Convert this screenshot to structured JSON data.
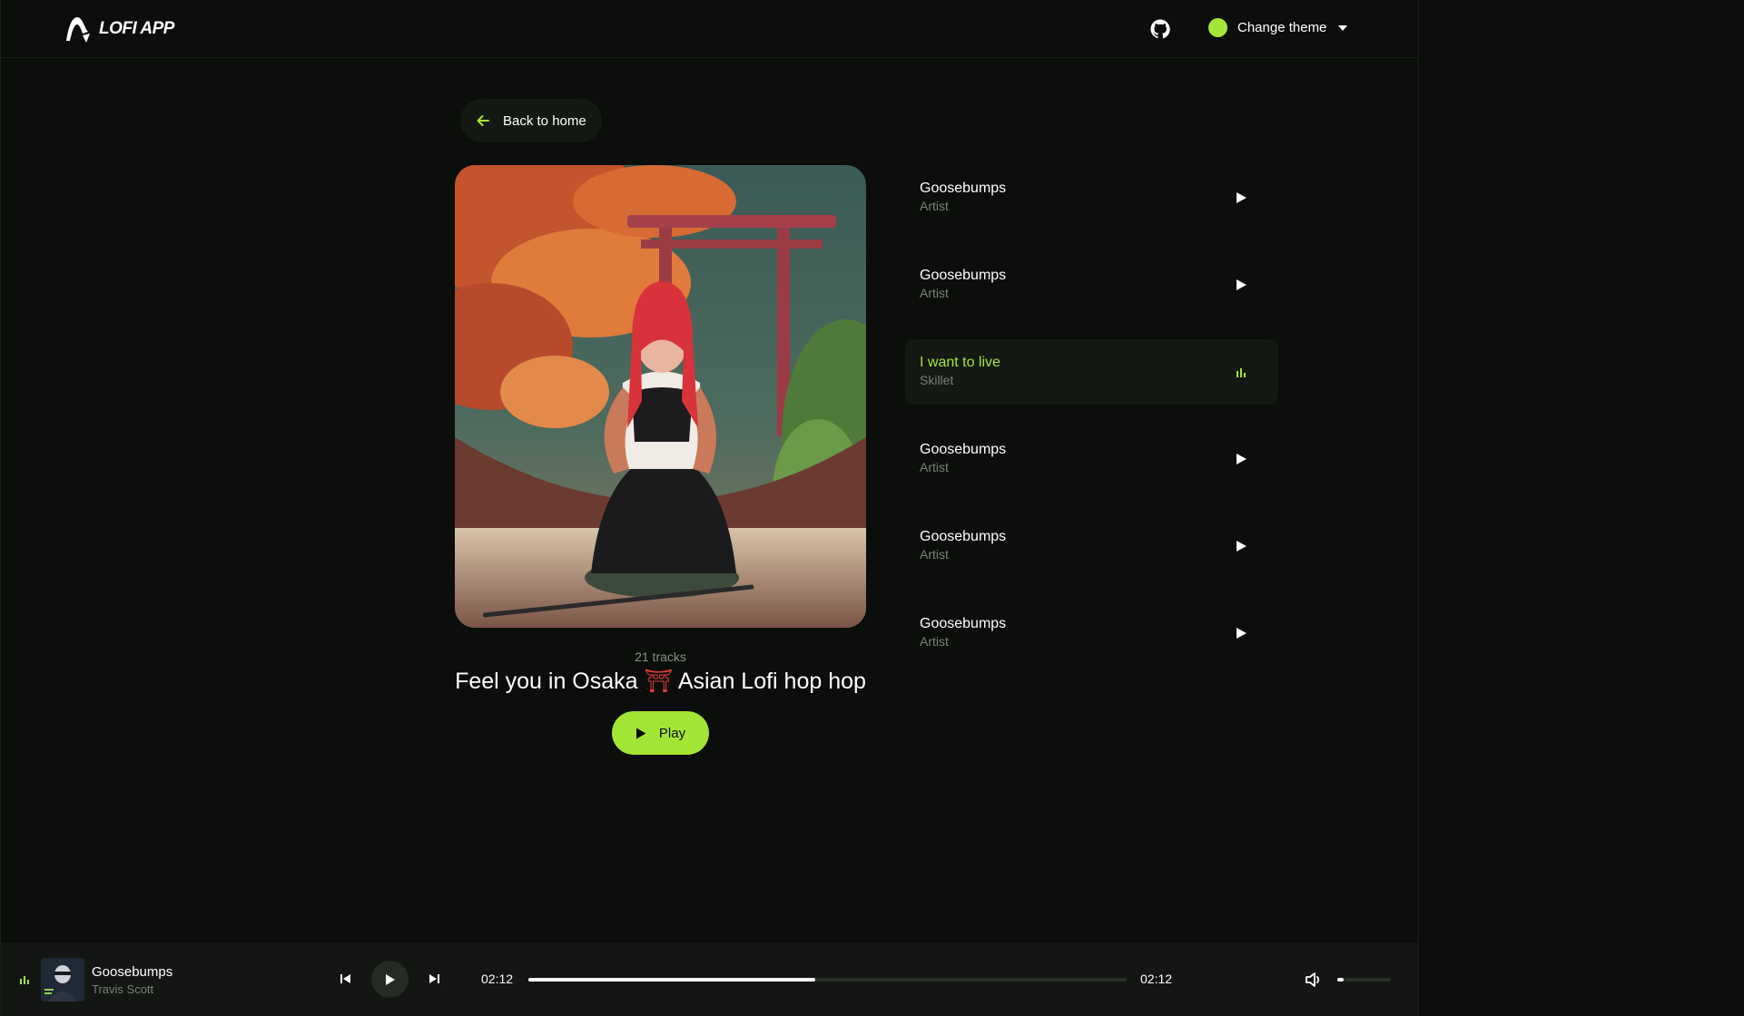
{
  "header": {
    "logo_text": "LOFI APP",
    "theme_label": "Change theme",
    "theme_color": "#a3e635"
  },
  "back": {
    "label": "Back to home"
  },
  "playlist": {
    "tracks_count": "21 tracks",
    "title_part1": "Feel you in Osaka ",
    "title_emoji": "⛩",
    "title_part2": " Asian Lofi hop hop",
    "play_label": "Play"
  },
  "tracks": [
    {
      "title": "Goosebumps",
      "artist": "Artist",
      "active": false
    },
    {
      "title": "Goosebumps",
      "artist": "Artist",
      "active": false
    },
    {
      "title": "I want to live",
      "artist": "Skillet",
      "active": true
    },
    {
      "title": "Goosebumps",
      "artist": "Artist",
      "active": false
    },
    {
      "title": "Goosebumps",
      "artist": "Artist",
      "active": false
    },
    {
      "title": "Goosebumps",
      "artist": "Artist",
      "active": false
    }
  ],
  "player": {
    "title": "Goosebumps",
    "artist": "Travis Scott",
    "current_time": "02:12",
    "total_time": "02:12",
    "progress_fraction": 0.48,
    "volume_fraction": 0.12
  },
  "colors": {
    "accent": "#a3e635",
    "background": "#0b0e0a"
  },
  "icons": [
    "github-icon",
    "arrow-left-icon",
    "play-icon",
    "equalizer-icon",
    "skip-back-icon",
    "skip-forward-icon",
    "volume-icon"
  ]
}
